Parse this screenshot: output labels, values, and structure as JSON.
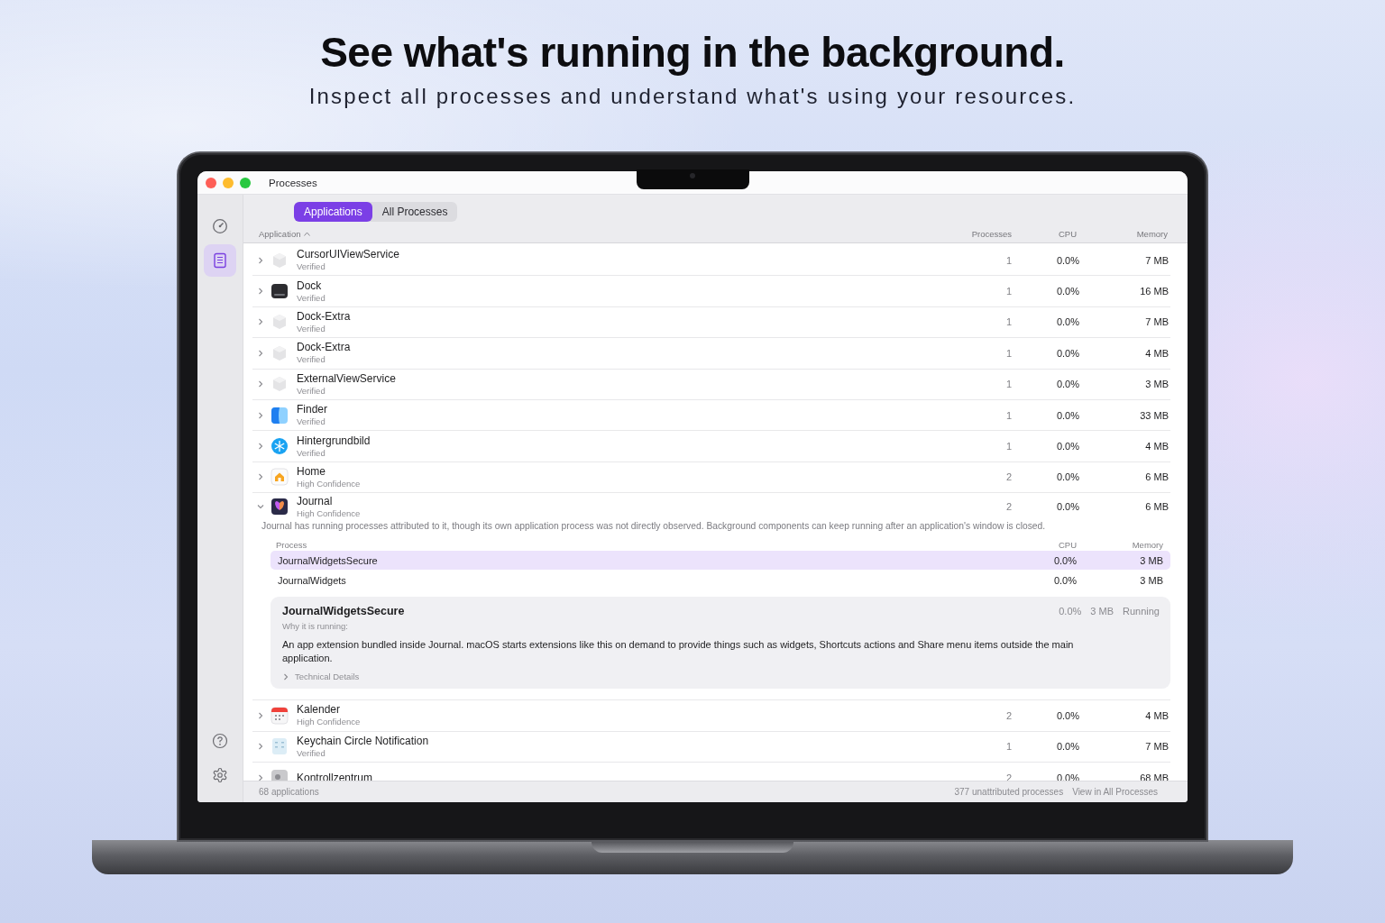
{
  "headline": "See what's running in the background.",
  "subheadline": "Inspect all processes and understand what's using your resources.",
  "window": {
    "title": "Processes"
  },
  "sidebar": {
    "items": [
      {
        "selected": false
      },
      {
        "selected": true
      }
    ]
  },
  "tabs": [
    {
      "label": "Applications",
      "selected": true
    },
    {
      "label": "All Processes",
      "selected": false
    }
  ],
  "table": {
    "columns": [
      {
        "label": "Application",
        "sorted": true
      },
      {
        "label": "Processes",
        "sorted": false
      },
      {
        "label": "CPU",
        "sorted": false
      },
      {
        "label": "Memory",
        "sorted": false
      }
    ],
    "rows": [
      {
        "name": "CursorUIViewService",
        "status": "Verified",
        "processes": "1",
        "cpu": "0.0%",
        "memory": "7 MB",
        "expanded": false
      },
      {
        "name": "Dock",
        "status": "Verified",
        "processes": "1",
        "cpu": "0.0%",
        "memory": "16 MB",
        "expanded": false
      },
      {
        "name": "Dock-Extra",
        "status": "Verified",
        "processes": "1",
        "cpu": "0.0%",
        "memory": "7 MB",
        "expanded": false
      },
      {
        "name": "Dock-Extra",
        "status": "Verified",
        "processes": "1",
        "cpu": "0.0%",
        "memory": "4 MB",
        "expanded": false
      },
      {
        "name": "ExternalViewService",
        "status": "Verified",
        "processes": "1",
        "cpu": "0.0%",
        "memory": "3 MB",
        "expanded": false
      },
      {
        "name": "Finder",
        "status": "Verified",
        "processes": "1",
        "cpu": "0.0%",
        "memory": "33 MB",
        "expanded": false
      },
      {
        "name": "Hintergrundbild",
        "status": "Verified",
        "processes": "1",
        "cpu": "0.0%",
        "memory": "4 MB",
        "expanded": false
      },
      {
        "name": "Home",
        "status": "High Confidence",
        "processes": "2",
        "cpu": "0.0%",
        "memory": "6 MB",
        "expanded": false
      },
      {
        "name": "Journal",
        "status": "High Confidence",
        "processes": "2",
        "cpu": "0.0%",
        "memory": "6 MB",
        "expanded": true,
        "details": {
          "note": "Journal has running processes attributed to it, though its own application process was not directly observed. Background components can keep running after an application's window is closed.",
          "columns": [
            "Process",
            "CPU",
            "Memory"
          ],
          "processes": [
            {
              "name": "JournalWidgetsSecure",
              "cpu": "0.0%",
              "memory": "3 MB",
              "selected": true
            },
            {
              "name": "JournalWidgets",
              "cpu": "0.0%",
              "memory": "3 MB",
              "selected": false
            }
          ],
          "inspector": {
            "title": "JournalWidgetsSecure",
            "cpu": "0.0%",
            "memory": "3 MB",
            "state": "Running",
            "why_label": "Why it is running:",
            "explanation": "An app extension bundled inside Journal. macOS starts extensions like this on demand to provide things such as widgets, Shortcuts actions and Share menu items outside the main application.",
            "technical_label": "Technical Details",
            "technical_expanded": false
          }
        }
      },
      {
        "name": "Kalender",
        "status": "High Confidence",
        "processes": "2",
        "cpu": "0.0%",
        "memory": "4 MB",
        "expanded": false
      },
      {
        "name": "Keychain Circle Notification",
        "status": "Verified",
        "processes": "1",
        "cpu": "0.0%",
        "memory": "7 MB",
        "expanded": false
      },
      {
        "name": "Kontrollzentrum",
        "processes": "2",
        "cpu": "0.0%",
        "memory": "68 MB",
        "expanded": false
      }
    ]
  },
  "status_bar": {
    "count": "68 applications",
    "unattributed": "377 unattributed processes",
    "link": "View in All Processes"
  }
}
